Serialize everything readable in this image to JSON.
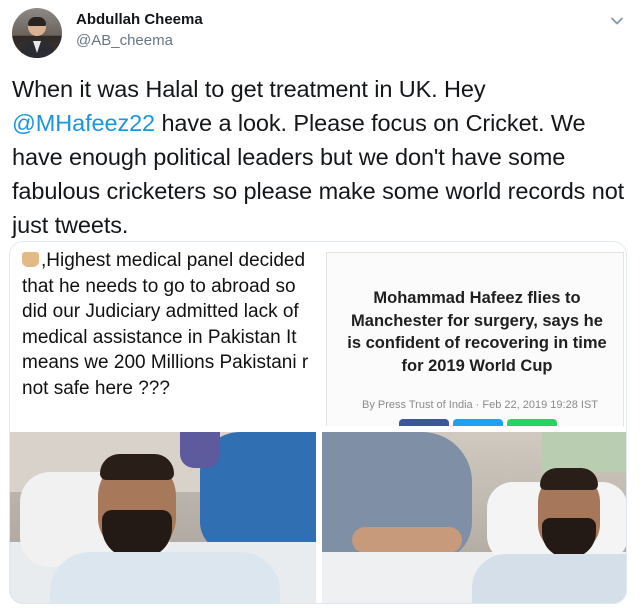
{
  "author": {
    "display_name": "Abdullah Cheema",
    "handle": "@AB_cheema"
  },
  "tweet": {
    "text_before_mention": "When it was Halal to get treatment in UK. Hey ",
    "mention": "@MHafeez22",
    "text_after_mention": " have a look. Please focus on Cricket. We have enough political leaders but we don't have some fabulous cricketers so please make some world records not just tweets."
  },
  "media": {
    "left_caption": ",Highest medical panel decided that he needs to go to abroad so did our Judiciary admitted lack of medical assistance in Pakistan It means we 200 Millions Pakistani r not safe here ???",
    "news_headline": "Mohammad Hafeez flies to Manchester for surgery, says he is confident of recovering in time for 2019 World Cup",
    "news_byline": "By Press Trust of India",
    "news_date": "· Feb 22, 2019 19:28 IST",
    "share_buttons": [
      "f",
      "t",
      "w"
    ]
  },
  "icons": {
    "caret": "chevron-down-icon",
    "emoji": "hand-emoji"
  },
  "colors": {
    "link": "#1b95e0",
    "secondary_text": "#657786",
    "facebook": "#3b5998",
    "twitter": "#1da1f2",
    "whatsapp": "#25d366"
  }
}
